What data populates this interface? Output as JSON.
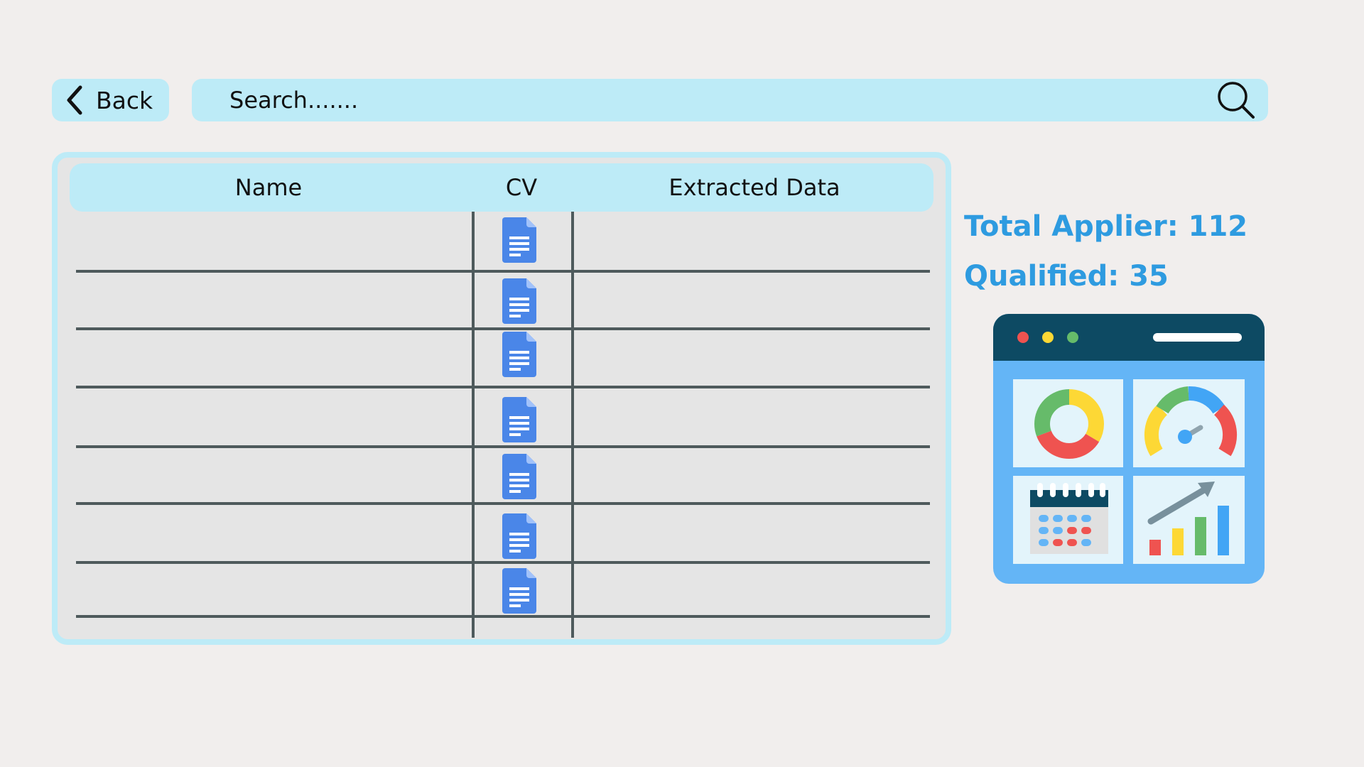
{
  "toolbar": {
    "back_label": "Back",
    "search_placeholder": "Search......."
  },
  "table": {
    "columns": [
      "Name",
      "CV",
      "Extracted Data"
    ],
    "rows": [
      {
        "name": "",
        "extracted_data": ""
      },
      {
        "name": "",
        "extracted_data": ""
      },
      {
        "name": "",
        "extracted_data": ""
      },
      {
        "name": "",
        "extracted_data": ""
      },
      {
        "name": "",
        "extracted_data": ""
      },
      {
        "name": "",
        "extracted_data": ""
      },
      {
        "name": "",
        "extracted_data": ""
      }
    ]
  },
  "stats": {
    "total_label": "Total Applier: 112",
    "qualified_label": "Qualified: 35"
  },
  "colors": {
    "accent": "#2e9be0",
    "bar_bg": "#bdebf7",
    "panel_bg": "#e5e5e5",
    "doc_icon": "#4a86e8"
  },
  "icons": {
    "back": "chevron-left-icon",
    "search": "magnifier-icon",
    "cv": "document-icon",
    "illustration": "dashboard-illustration"
  }
}
